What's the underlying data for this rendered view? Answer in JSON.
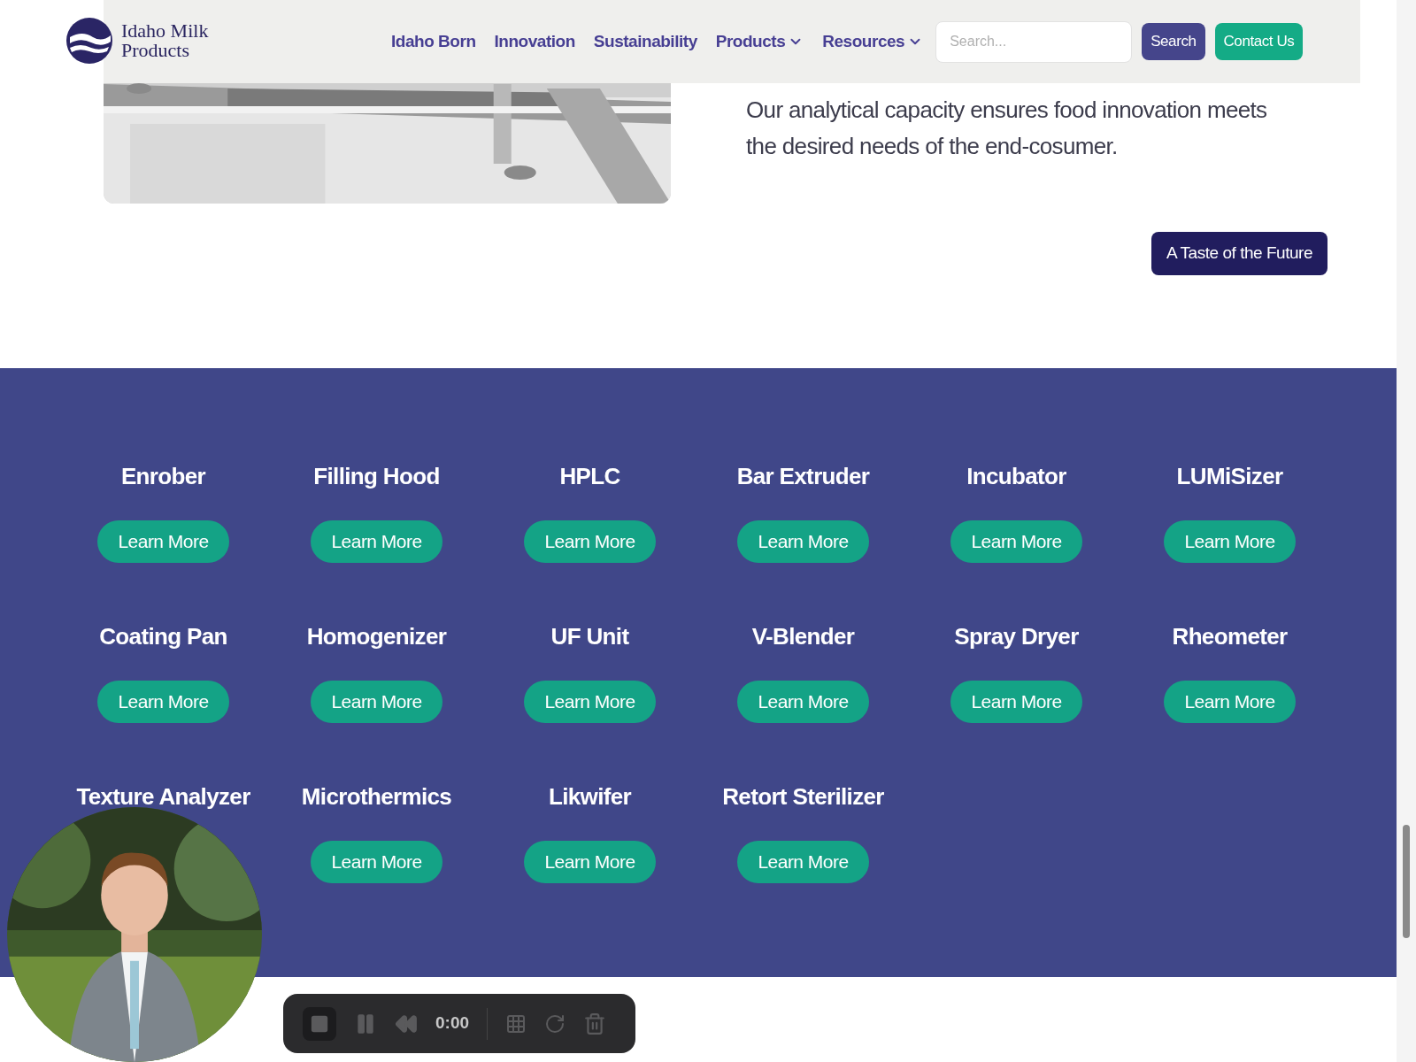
{
  "header": {
    "logo_lines": [
      "Idaho Milk",
      "Products"
    ],
    "nav": [
      {
        "label": "Idaho Born",
        "dropdown": false
      },
      {
        "label": "Innovation",
        "dropdown": false
      },
      {
        "label": "Sustainability",
        "dropdown": false
      },
      {
        "label": "Products",
        "dropdown": true
      },
      {
        "label": "Resources",
        "dropdown": true
      }
    ],
    "search": {
      "placeholder": "Search..."
    },
    "buttons": [
      "Search",
      "Contact Us"
    ]
  },
  "intro": {
    "text": "Our analytical capacity ensures food innovation meets the desired needs of the end-cosumer.",
    "button": "A Taste of the Future"
  },
  "equipment": [
    {
      "name": "Enrober",
      "button": "Learn More"
    },
    {
      "name": "Filling Hood",
      "button": "Learn More"
    },
    {
      "name": "HPLC",
      "button": "Learn More"
    },
    {
      "name": "Bar Extruder",
      "button": "Learn More"
    },
    {
      "name": "Incubator",
      "button": "Learn More"
    },
    {
      "name": "LUMiSizer",
      "button": "Learn More"
    },
    {
      "name": "Coating Pan",
      "button": "Learn More"
    },
    {
      "name": "Homogenizer",
      "button": "Learn More"
    },
    {
      "name": "UF Unit",
      "button": "Learn More"
    },
    {
      "name": "V-Blender",
      "button": "Learn More"
    },
    {
      "name": "Spray Dryer",
      "button": "Learn More"
    },
    {
      "name": "Rheometer",
      "button": "Learn More"
    },
    {
      "name": "Texture Analyzer"
    },
    {
      "name": "Microthermics",
      "button": "Learn More"
    },
    {
      "name": "Likwifer",
      "button": "Learn More"
    },
    {
      "name": "Retort Sterilizer",
      "button": "Learn More"
    }
  ],
  "recorder": {
    "time": "0:00"
  }
}
